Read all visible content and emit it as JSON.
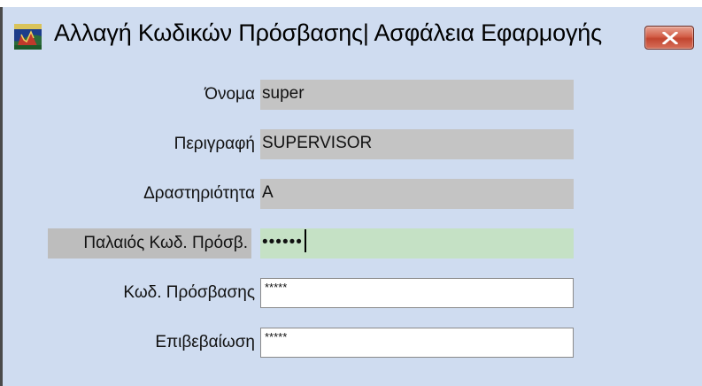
{
  "window": {
    "title": "Αλλαγή Κωδικών Πρόσβασης| Ασφάλεια Εφαρμογής",
    "close_icon": "close-x-icon",
    "app_icon": "app-logo-icon"
  },
  "form": {
    "fields": [
      {
        "label": "Όνομα",
        "value": "super",
        "state": "readonly"
      },
      {
        "label": "Περιγραφή",
        "value": "SUPERVISOR",
        "state": "readonly"
      },
      {
        "label": "Δραστηριότητα",
        "value": "A",
        "state": "readonly"
      },
      {
        "label": "Παλαιός Κωδ. Πρόσβ.",
        "value": "••••••",
        "state": "focused"
      },
      {
        "label": "Κωδ. Πρόσβασης",
        "value": "*****",
        "state": "editable"
      },
      {
        "label": "Επιβεβαίωση",
        "value": "*****",
        "state": "editable"
      }
    ]
  },
  "colors": {
    "window_bg": "#cfdcf0",
    "readonly_bg": "#c4c4c4",
    "focused_bg": "#c5e1c5",
    "close_btn": "#c24530"
  }
}
